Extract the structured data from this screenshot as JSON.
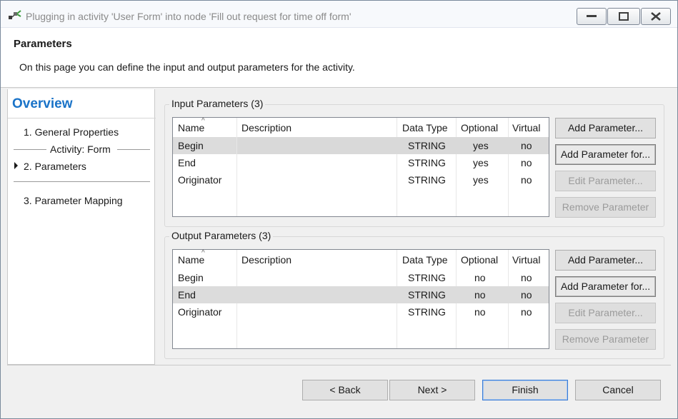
{
  "window": {
    "title": "Plugging in activity 'User Form' into node 'Fill out request for time off form'"
  },
  "header": {
    "title": "Parameters",
    "description": "On this page you can define the input and output parameters for the activity."
  },
  "nav": {
    "title": "Overview",
    "items": [
      {
        "label": "1.  General Properties"
      },
      {
        "label": "2.  Parameters"
      },
      {
        "label": "3.  Parameter Mapping"
      }
    ],
    "separator_label": "Activity: Form"
  },
  "columns": [
    "Name",
    "Description",
    "Data Type",
    "Optional",
    "Virtual"
  ],
  "input_parameters": {
    "label": "Input Parameters (3)",
    "rows": [
      {
        "name": "Begin",
        "description": "",
        "data_type": "STRING",
        "optional": "yes",
        "virtual": "no"
      },
      {
        "name": "End",
        "description": "",
        "data_type": "STRING",
        "optional": "yes",
        "virtual": "no"
      },
      {
        "name": "Originator",
        "description": "",
        "data_type": "STRING",
        "optional": "yes",
        "virtual": "no"
      }
    ]
  },
  "output_parameters": {
    "label": "Output Parameters (3)",
    "rows": [
      {
        "name": "Begin",
        "description": "",
        "data_type": "STRING",
        "optional": "no",
        "virtual": "no"
      },
      {
        "name": "End",
        "description": "",
        "data_type": "STRING",
        "optional": "no",
        "virtual": "no"
      },
      {
        "name": "Originator",
        "description": "",
        "data_type": "STRING",
        "optional": "no",
        "virtual": "no"
      }
    ]
  },
  "param_buttons": {
    "add": "Add Parameter...",
    "add_for": "Add Parameter for...",
    "edit": "Edit Parameter...",
    "remove": "Remove Parameter"
  },
  "footer": {
    "back": "< Back",
    "next": "Next >",
    "finish": "Finish",
    "cancel": "Cancel"
  },
  "icons": {
    "app": "plug-activity-icon",
    "minimize": "minimize-icon",
    "maximize": "maximize-icon",
    "close": "close-icon"
  },
  "colors": {
    "overview_title": "#1a73c8",
    "selected_row": "#dcdcdc",
    "default_button_border": "#3a7bd5"
  }
}
